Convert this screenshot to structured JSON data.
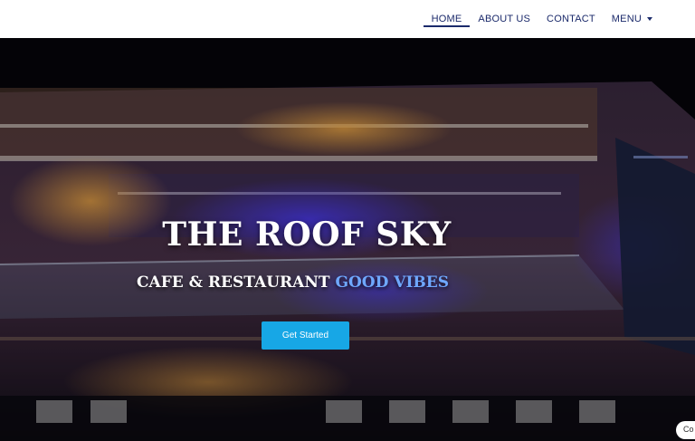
{
  "nav": {
    "items": [
      {
        "label": "HOME"
      },
      {
        "label": "ABOUT US"
      },
      {
        "label": "CONTACT"
      },
      {
        "label": "MENU"
      }
    ]
  },
  "hero": {
    "title": "THE ROOF SKY",
    "subtitle_main": "CAFE & RESTAURANT",
    "subtitle_accent": "GOOD VIBES",
    "cta_label": "Get Started"
  },
  "chat": {
    "label": "Co"
  },
  "colors": {
    "nav_text": "#1b2a6b",
    "cta": "#17a7e6",
    "accent_text": "#6fa8ff"
  }
}
